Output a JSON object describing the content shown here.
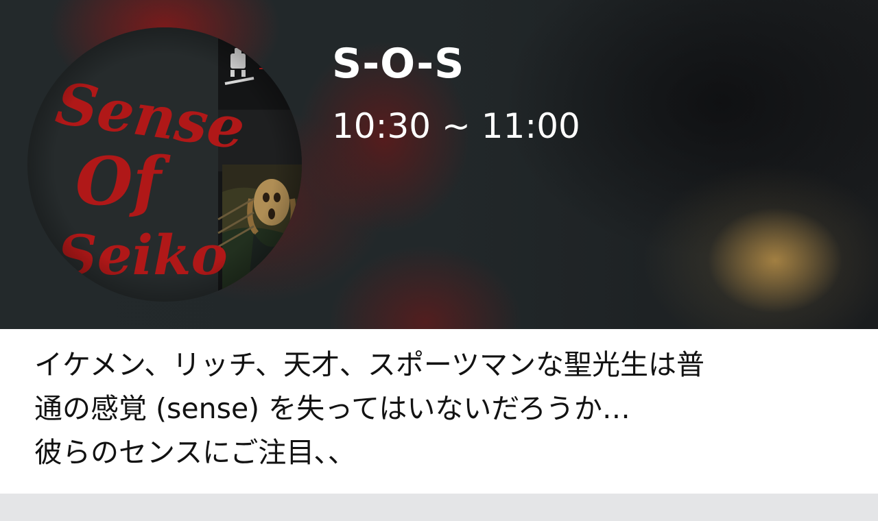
{
  "program": {
    "title": "S-O-S",
    "time": "10:30 ~ 11:00",
    "cover": {
      "logo_lines": [
        "Sense",
        "Of",
        "Seiko"
      ],
      "logo_color": "#b01818",
      "background_color": "#262b2c"
    },
    "description": [
      "イケメン、リッチ、天才、スポーツマンな聖光生は普",
      "通の感覚 (sense) を失ってはいないだろうか…",
      "彼らのセンスにご注目､､"
    ]
  },
  "colors": {
    "hero_background": "#1d2224",
    "title_text": "#ffffff",
    "description_text": "#121212",
    "page_background": "#e4e5e7"
  }
}
